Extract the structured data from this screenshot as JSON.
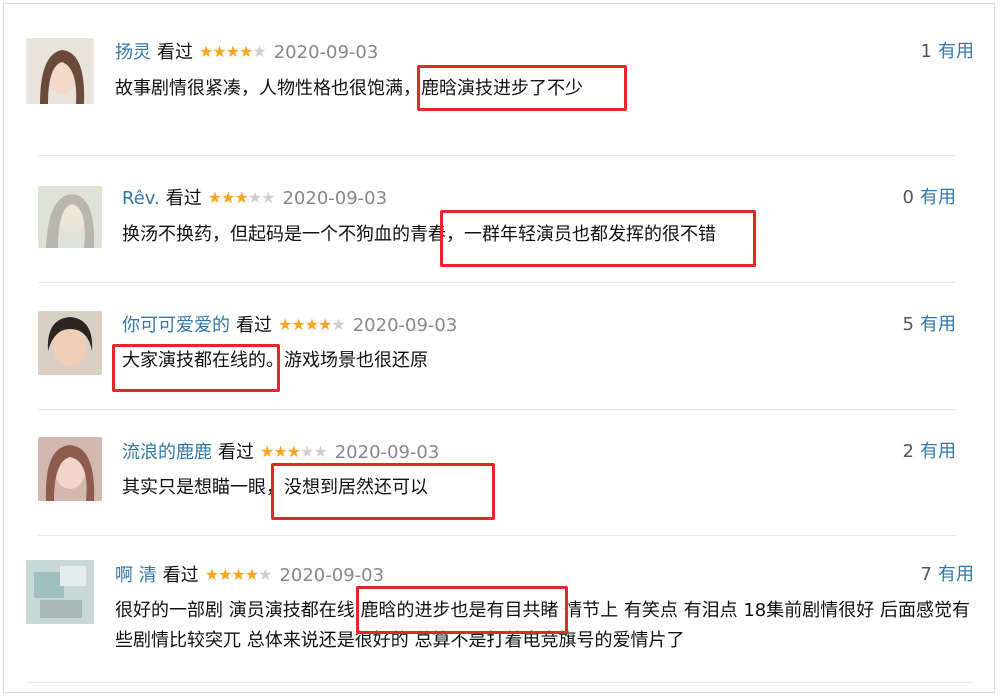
{
  "vote_label": "有用",
  "seen_label": "看过",
  "reviews": [
    {
      "user": "扬灵",
      "rating": 4,
      "date": "2020-09-03",
      "votes": "1",
      "text": "故事剧情很紧凑，人物性格也很饱满，鹿晗演技进步了不少"
    },
    {
      "user": "Rêv.",
      "rating": 3,
      "date": "2020-09-03",
      "votes": "0",
      "text": "换汤不换药，但起码是一个不狗血的青春，一群年轻演员也都发挥的很不错"
    },
    {
      "user": "你可可爱爱的",
      "rating": 4,
      "date": "2020-09-03",
      "votes": "5",
      "text": "大家演技都在线的。游戏场景也很还原"
    },
    {
      "user": "流浪的鹿鹿",
      "rating": 3,
      "date": "2020-09-03",
      "votes": "2",
      "text": "其实只是想瞄一眼，没想到居然还可以"
    },
    {
      "user": "啊 清",
      "rating": 4,
      "date": "2020-09-03",
      "votes": "7",
      "text": "很好的一部剧 演员演技都在线 鹿晗的进步也是有目共睹 情节上 有笑点 有泪点 18集前剧情很好 后面感觉有些剧情比较突兀 总体来说还是很好的 总算不是打着电竞旗号的爱情片了"
    }
  ],
  "colors": {
    "link": "#3377aa",
    "star": "#f5a623",
    "highlight": "#e4282a"
  }
}
